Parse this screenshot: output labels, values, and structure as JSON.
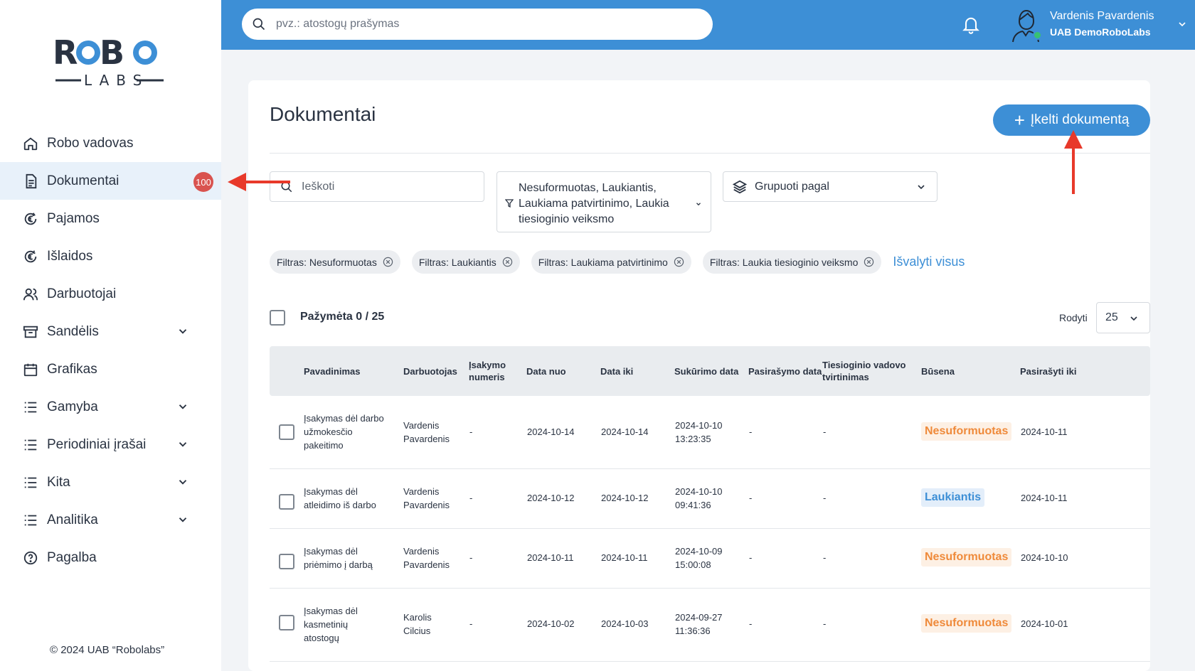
{
  "sidebar": {
    "logo_top": "ROBO",
    "logo_bottom": "LABS",
    "items": [
      {
        "label": "Robo vadovas",
        "icon": "home-icon"
      },
      {
        "label": "Dokumentai",
        "icon": "document-icon",
        "badge": "100",
        "active": true
      },
      {
        "label": "Pajamos",
        "icon": "euro-income-icon"
      },
      {
        "label": "Išlaidos",
        "icon": "euro-expense-icon"
      },
      {
        "label": "Darbuotojai",
        "icon": "users-icon"
      },
      {
        "label": "Sandėlis",
        "icon": "archive-icon",
        "expandable": true
      },
      {
        "label": "Grafikas",
        "icon": "calendar-icon"
      },
      {
        "label": "Gamyba",
        "icon": "list-icon",
        "expandable": true
      },
      {
        "label": "Periodiniai įrašai",
        "icon": "list-icon",
        "expandable": true
      },
      {
        "label": "Kita",
        "icon": "list-icon",
        "expandable": true
      },
      {
        "label": "Analitika",
        "icon": "list-icon",
        "expandable": true
      },
      {
        "label": "Pagalba",
        "icon": "help-icon"
      }
    ],
    "copyright": "© 2024 UAB “Robolabs”"
  },
  "topbar": {
    "search_placeholder": "pvz.: atostogų prašymas",
    "user_name": "Vardenis Pavardenis",
    "user_company": "UAB DemoRoboLabs",
    "accent": "#3d8fd6"
  },
  "main": {
    "title": "Dokumentai",
    "upload_label": "Įkelti dokumentą",
    "search_placeholder": "Ieškoti",
    "status_filter_text": "Nesuformuotas, Laukiantis, Laukiama patvirtinimo, Laukia tiesioginio veiksmo",
    "group_by_label": "Grupuoti pagal",
    "chips": [
      "Filtras: Nesuformuotas",
      "Filtras: Laukiantis",
      "Filtras: Laukiama patvirtinimo",
      "Filtras: Laukia tiesioginio veiksmo"
    ],
    "clear_all": "Išvalyti visus",
    "selected_count": "Pažymėta 0 / 25",
    "show_label": "Rodyti",
    "page_size": "25"
  },
  "table": {
    "columns": [
      "Pavadinimas",
      "Darbuotojas",
      "Įsakymo numeris",
      "Data nuo",
      "Data iki",
      "Sukūrimo data",
      "Pasirašymo data",
      "Tiesioginio vadovo tvirtinimas",
      "Būsena",
      "Pasirašyti iki"
    ],
    "rows": [
      {
        "name": "Įsakymas dėl darbo užmokesčio pakeitimo",
        "employee": "Vardenis Pavardenis",
        "order_no": "-",
        "date_from": "2024-10-14",
        "date_to": "2024-10-14",
        "created": "2024-10-10 13:23:35",
        "signed": "-",
        "approval": "-",
        "status": "Nesuformuotas",
        "status_color": "#ef8a3a",
        "sign_by": "2024-10-11"
      },
      {
        "name": "Įsakymas dėl atleidimo iš darbo",
        "employee": "Vardenis Pavardenis",
        "order_no": "-",
        "date_from": "2024-10-12",
        "date_to": "2024-10-12",
        "created": "2024-10-10 09:41:36",
        "signed": "-",
        "approval": "-",
        "status": "Laukiantis",
        "status_color": "#3d8fd6",
        "sign_by": "2024-10-11"
      },
      {
        "name": "Įsakymas dėl priėmimo į darbą",
        "employee": "Vardenis Pavardenis",
        "order_no": "-",
        "date_from": "2024-10-11",
        "date_to": "2024-10-11",
        "created": "2024-10-09 15:00:08",
        "signed": "-",
        "approval": "-",
        "status": "Nesuformuotas",
        "status_color": "#ef8a3a",
        "sign_by": "2024-10-10"
      },
      {
        "name": "Įsakymas dėl kasmetinių atostogų",
        "employee": "Karolis Cilcius",
        "order_no": "-",
        "date_from": "2024-10-02",
        "date_to": "2024-10-03",
        "created": "2024-09-27 11:36:36",
        "signed": "-",
        "approval": "-",
        "status": "Nesuformuotas",
        "status_color": "#ef8a3a",
        "sign_by": "2024-10-01"
      }
    ]
  }
}
